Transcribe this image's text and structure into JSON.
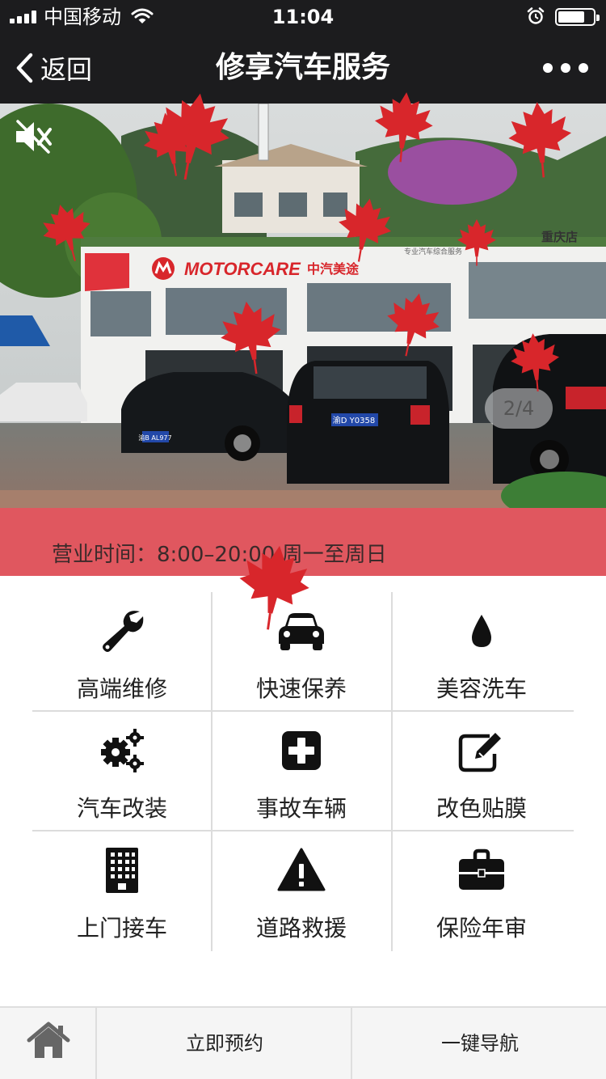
{
  "status_bar": {
    "carrier": "中国移动",
    "time": "11:04",
    "battery_level": 0.75
  },
  "nav": {
    "back_label": "返回",
    "title": "修享汽车服务",
    "more_icon": "more-dots-icon"
  },
  "banner": {
    "pager_text": "2/4",
    "current_slide": 2,
    "total_slides": 4,
    "sign_brand": "MOTORCARE",
    "sign_cn": "中汽美途",
    "sign_sub": "专业汽车综合服务",
    "sign_city": "重庆店",
    "plate_left": "渝B AL977",
    "plate_center": "渝D Y0358",
    "mute_icon": "speaker-muted-icon"
  },
  "hours": {
    "text": "营业时间：8:00–20:00 周一至周日",
    "background": "#e0575f"
  },
  "services": [
    {
      "label": "高端维修",
      "icon": "wrench-icon"
    },
    {
      "label": "快速保养",
      "icon": "car-icon"
    },
    {
      "label": "美容洗车",
      "icon": "water-drop-icon"
    },
    {
      "label": "汽车改装",
      "icon": "gears-icon"
    },
    {
      "label": "事故车辆",
      "icon": "plus-square-icon"
    },
    {
      "label": "改色贴膜",
      "icon": "edit-icon"
    },
    {
      "label": "上门接车",
      "icon": "building-icon"
    },
    {
      "label": "道路救援",
      "icon": "warning-icon"
    },
    {
      "label": "保险年审",
      "icon": "briefcase-icon"
    }
  ],
  "toolbar": {
    "home_icon": "home-icon",
    "book_label": "立即预约",
    "navigate_label": "一键导航"
  },
  "colors": {
    "bar_bg": "#1c1c1e",
    "leaf": "#d8262b",
    "accent": "#e0575f"
  }
}
